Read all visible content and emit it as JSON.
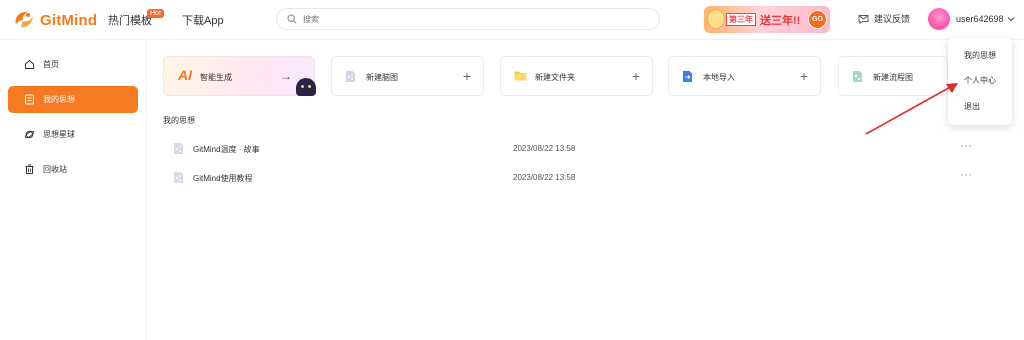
{
  "app": {
    "logo_text": "GitMind",
    "brand_color": "#f57a21"
  },
  "header": {
    "nav": [
      {
        "label": "热门模板",
        "badge": "Hot"
      },
      {
        "label": "下载App"
      }
    ],
    "search": {
      "placeholder": "搜索"
    },
    "promo": {
      "pill": "第三年",
      "text": "送三年!!",
      "button": "GO"
    },
    "feedback_label": "建议反馈",
    "username": "user642698"
  },
  "sidebar": {
    "items": [
      {
        "label": "首页",
        "icon": "home-icon",
        "active": false
      },
      {
        "label": "我的思想",
        "icon": "document-icon",
        "active": true
      },
      {
        "label": "思想星球",
        "icon": "planet-icon",
        "active": false
      },
      {
        "label": "回收站",
        "icon": "trash-icon",
        "active": false
      }
    ]
  },
  "quick_actions": [
    {
      "label": "智能生成",
      "icon": "ai-icon",
      "action": "→"
    },
    {
      "label": "新建脑图",
      "icon": "mindmap-file-icon",
      "action": "+"
    },
    {
      "label": "新建文件夹",
      "icon": "folder-icon",
      "action": "+"
    },
    {
      "label": "本地导入",
      "icon": "import-icon",
      "action": "+"
    },
    {
      "label": "新建流程图",
      "icon": "flowchart-file-icon",
      "action": "+"
    }
  ],
  "section_title": "我的思想",
  "files": [
    {
      "name": "GitMind温度 · 故事",
      "date": "2023/08/22 13:58"
    },
    {
      "name": "GitMind使用教程",
      "date": "2023/08/22 13:58"
    }
  ],
  "more_label": "···",
  "dropdown": {
    "items": [
      "我的思想",
      "个人中心",
      "退出"
    ]
  },
  "colors": {
    "accent": "#f57a21",
    "annotation": "#e02b2b"
  }
}
